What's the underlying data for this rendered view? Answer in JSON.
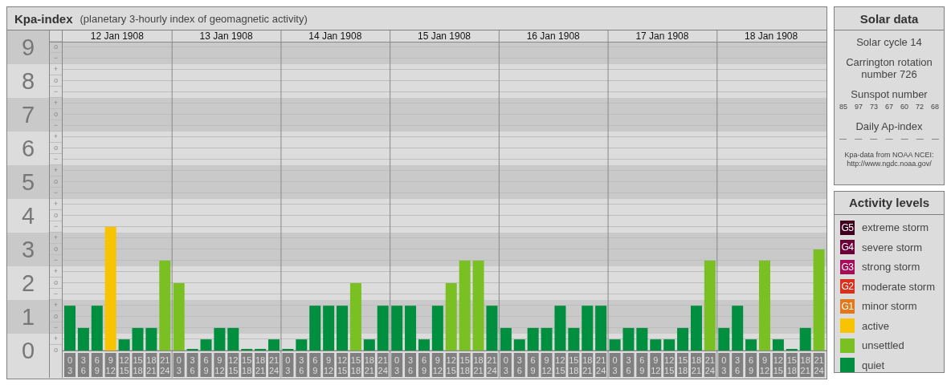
{
  "header": {
    "title": "Kpa-index",
    "subtitle": "(planetary 3-hourly index of geomagnetic activity)"
  },
  "dates": [
    "12 Jan 1908",
    "13 Jan 1908",
    "14 Jan 1908",
    "15 Jan 1908",
    "16 Jan 1908",
    "17 Jan 1908",
    "18 Jan 1908"
  ],
  "minor_marks": [
    "o",
    "−",
    "+",
    "o",
    "−",
    "+",
    "o",
    "−",
    "+",
    "o",
    "−",
    "+",
    "o",
    "−",
    "+",
    "o",
    "−",
    "+",
    "o",
    "−",
    "+",
    "o",
    "−",
    "+",
    "o",
    "−",
    "+",
    "o"
  ],
  "chart_data": {
    "type": "bar",
    "stacked": true,
    "ylim": [
      0,
      9.5
    ],
    "grid": true,
    "yticks": [
      {
        "value": 9,
        "label": "9"
      },
      {
        "value": 8,
        "label": "8"
      },
      {
        "value": 7,
        "label": "7"
      },
      {
        "value": 6,
        "label": "6"
      },
      {
        "value": 5,
        "label": "5"
      },
      {
        "value": 4,
        "label": "4"
      },
      {
        "value": 3,
        "label": "3"
      },
      {
        "value": 2,
        "label": "2"
      },
      {
        "value": 1,
        "label": "1"
      },
      {
        "value": 0,
        "label": "0"
      }
    ],
    "categories": [
      [
        "0",
        "3"
      ],
      [
        "3",
        "6"
      ],
      [
        "6",
        "9"
      ],
      [
        "9",
        "12"
      ],
      [
        "12",
        "15"
      ],
      [
        "15",
        "18"
      ],
      [
        "18",
        "21"
      ],
      [
        "21",
        "24"
      ],
      [
        "0",
        "3"
      ],
      [
        "3",
        "6"
      ],
      [
        "6",
        "9"
      ],
      [
        "9",
        "12"
      ],
      [
        "12",
        "15"
      ],
      [
        "15",
        "18"
      ],
      [
        "18",
        "21"
      ],
      [
        "21",
        "24"
      ],
      [
        "0",
        "3"
      ],
      [
        "3",
        "6"
      ],
      [
        "6",
        "9"
      ],
      [
        "9",
        "12"
      ],
      [
        "12",
        "15"
      ],
      [
        "15",
        "18"
      ],
      [
        "18",
        "21"
      ],
      [
        "21",
        "24"
      ],
      [
        "0",
        "3"
      ],
      [
        "3",
        "6"
      ],
      [
        "6",
        "9"
      ],
      [
        "9",
        "12"
      ],
      [
        "12",
        "15"
      ],
      [
        "15",
        "18"
      ],
      [
        "18",
        "21"
      ],
      [
        "21",
        "24"
      ],
      [
        "0",
        "3"
      ],
      [
        "3",
        "6"
      ],
      [
        "6",
        "9"
      ],
      [
        "9",
        "12"
      ],
      [
        "12",
        "15"
      ],
      [
        "15",
        "18"
      ],
      [
        "18",
        "21"
      ],
      [
        "21",
        "24"
      ],
      [
        "0",
        "3"
      ],
      [
        "3",
        "6"
      ],
      [
        "6",
        "9"
      ],
      [
        "9",
        "12"
      ],
      [
        "12",
        "15"
      ],
      [
        "15",
        "18"
      ],
      [
        "18",
        "21"
      ],
      [
        "21",
        "24"
      ],
      [
        "0",
        "3"
      ],
      [
        "3",
        "6"
      ],
      [
        "6",
        "9"
      ],
      [
        "9",
        "12"
      ],
      [
        "12",
        "15"
      ],
      [
        "15",
        "18"
      ],
      [
        "18",
        "21"
      ],
      [
        "21",
        "24"
      ]
    ],
    "series": [
      {
        "name": "active",
        "color": "#f8c300",
        "values": [
          null,
          null,
          null,
          3.67,
          null,
          null,
          null,
          null,
          null,
          null,
          null,
          null,
          null,
          null,
          null,
          null,
          null,
          null,
          null,
          null,
          null,
          null,
          null,
          null,
          null,
          null,
          null,
          null,
          null,
          null,
          null,
          null,
          null,
          null,
          null,
          null,
          null,
          null,
          null,
          null,
          null,
          null,
          null,
          null,
          null,
          null,
          null,
          null,
          null,
          null,
          null,
          null,
          null,
          null,
          null,
          null
        ]
      },
      {
        "name": "unsettled",
        "color": "#7bc022",
        "values": [
          null,
          null,
          null,
          null,
          null,
          null,
          null,
          2.67,
          2,
          null,
          null,
          null,
          null,
          null,
          null,
          null,
          null,
          null,
          null,
          null,
          null,
          2,
          null,
          null,
          null,
          null,
          null,
          null,
          2,
          2.67,
          2.67,
          null,
          null,
          null,
          null,
          null,
          null,
          null,
          null,
          null,
          null,
          null,
          null,
          null,
          null,
          null,
          null,
          2.67,
          null,
          null,
          null,
          2.67,
          null,
          null,
          null,
          3
        ]
      },
      {
        "name": "quiet",
        "color": "#008f3e",
        "values": [
          1.33,
          0.67,
          1.33,
          null,
          0.33,
          0.67,
          0.67,
          null,
          null,
          0,
          0.33,
          0.67,
          0.67,
          0,
          0,
          0.33,
          0,
          0.33,
          1.33,
          1.33,
          1.33,
          null,
          0.33,
          1.33,
          1.33,
          1.33,
          0.33,
          1.33,
          null,
          null,
          null,
          1.33,
          0.67,
          0.33,
          0.67,
          0.67,
          1.33,
          0.67,
          1.33,
          1.33,
          0.33,
          0.67,
          0.67,
          0.33,
          0.33,
          0.67,
          1.33,
          null,
          0.67,
          1.33,
          0.33,
          null,
          0.33,
          0,
          0.67,
          null
        ]
      }
    ]
  },
  "solar_data": {
    "title": "Solar data",
    "solar_cycle": "Solar cycle 14",
    "carrington": "Carrington rotation number 726",
    "sunspot_title": "Sunspot number",
    "sunspot_numbers": [
      "85",
      "97",
      "73",
      "67",
      "60",
      "72",
      "68"
    ],
    "ap_title": "Daily Ap-index",
    "ap_values": [
      "—",
      "—",
      "—",
      "—",
      "—",
      "—",
      "—"
    ],
    "source": "Kpa-data from NOAA NCEI: http://www.ngdc.noaa.gov/"
  },
  "activity_levels": {
    "title": "Activity levels",
    "items": [
      {
        "code": "G5",
        "label": "extreme storm",
        "color": "#3f0020"
      },
      {
        "code": "G4",
        "label": "severe storm",
        "color": "#6b0038"
      },
      {
        "code": "G3",
        "label": "strong storm",
        "color": "#a50d5b"
      },
      {
        "code": "G2",
        "label": "moderate storm",
        "color": "#d9301c"
      },
      {
        "code": "G1",
        "label": "minor storm",
        "color": "#e2781a"
      }
    ]
  }
}
